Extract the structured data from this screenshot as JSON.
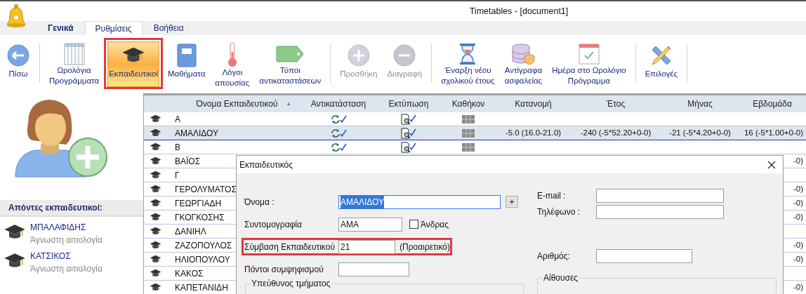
{
  "window": {
    "title": "Timetables - [document1]"
  },
  "tabs": [
    {
      "kind": "file",
      "label": "Γενικά",
      "selected": false
    },
    {
      "kind": "tab",
      "label": "Ρυθμίσεις",
      "selected": true
    },
    {
      "kind": "tab",
      "label": "Βοήθεια",
      "selected": false
    }
  ],
  "toolbar": [
    {
      "kind": "button",
      "label": "Πίσω",
      "selected": false,
      "disabled": false,
      "highlighted": false
    },
    {
      "kind": "separator"
    },
    {
      "kind": "button",
      "label": "Ωρολόγια\nΠρογράμματα",
      "selected": false,
      "disabled": false,
      "highlighted": false
    },
    {
      "kind": "button",
      "label": "Εκπαιδευτικοί",
      "selected": true,
      "disabled": false,
      "highlighted": true
    },
    {
      "kind": "button",
      "label": "Μαθήματα",
      "selected": false,
      "disabled": false,
      "highlighted": false
    },
    {
      "kind": "button",
      "label": "Λόγοι\nαπουσίας",
      "selected": false,
      "disabled": false,
      "highlighted": false
    },
    {
      "kind": "button",
      "label": "Τύποι\nαντικαταστάσεων",
      "selected": false,
      "disabled": false,
      "highlighted": false
    },
    {
      "kind": "separator"
    },
    {
      "kind": "button",
      "label": "Προσθήκη",
      "selected": false,
      "disabled": true,
      "highlighted": false
    },
    {
      "kind": "button",
      "label": "Διαγραφή",
      "selected": false,
      "disabled": true,
      "highlighted": false
    },
    {
      "kind": "separator"
    },
    {
      "kind": "button",
      "label": "Έναρξη νέου\nσχολικού έτους",
      "selected": false,
      "disabled": false,
      "highlighted": false
    },
    {
      "kind": "button",
      "label": "Αντίγραφα\nασφαλείας",
      "selected": false,
      "disabled": false,
      "highlighted": false
    },
    {
      "kind": "button",
      "label": "Ημέρα στο Ωρολόγιο\nΠρόγραμμα",
      "selected": false,
      "disabled": false,
      "highlighted": false
    },
    {
      "kind": "separator"
    },
    {
      "kind": "button",
      "label": "Επιλογές",
      "selected": false,
      "disabled": false,
      "highlighted": false
    },
    {
      "kind": "separator"
    }
  ],
  "absent_teachers": {
    "title": "Απόντες εκπαιδευτικοί:",
    "items": [
      {
        "name": "ΜΠΑΛΑΦΙΔΗΣ",
        "reason": "Άγνωστη αιτιολογία"
      },
      {
        "name": "ΚΑΤΣΙΚΟΣ",
        "reason": "Άγνωστη αιτιολογία"
      }
    ]
  },
  "table": {
    "columns": [
      {
        "label": "Όνομα Εκπαιδευτικού",
        "sort_arrow": "▲"
      },
      {
        "label": "Αντικατάσταση"
      },
      {
        "label": "Εκτύπωση"
      },
      {
        "label": "Καθήκον"
      },
      {
        "label": "Κατανομή"
      },
      {
        "label": "Έτος"
      },
      {
        "label": "Μήνας"
      },
      {
        "label": "Εβδομάδα"
      }
    ],
    "rows": [
      {
        "name": "Α",
        "selected": false,
        "icons_visible": true
      },
      {
        "name": "ΑΜΑΛΙΔΟΥ",
        "selected": true,
        "icons_visible": true,
        "allocation": "-5.0 (16.0-21.0)",
        "year": "-240 (-5*52.20+0-0)",
        "month": "-21 (-5*4.20+0-0)",
        "week": "16 (-5*1.00+0-0)"
      },
      {
        "name": "Β",
        "selected": false,
        "icons_visible": true
      },
      {
        "name": "ΒΑΪΟΣ",
        "selected": false,
        "week": "-0)"
      },
      {
        "name": "Γ",
        "selected": false
      },
      {
        "name": "ΓΕΡΟΛΥΜΑΤΟΣ",
        "selected": false,
        "week": "-0)"
      },
      {
        "name": "ΓΕΩΡΓΙΑΔΗ",
        "selected": false,
        "week": "-0)"
      },
      {
        "name": "ΓΚΟΓΚΟΣΗΣ",
        "selected": false,
        "week": "-0)"
      },
      {
        "name": "ΔΑΝΙΗΛ",
        "selected": false
      },
      {
        "name": "ΖΑΖΟΠΟΥΛΟΣ",
        "selected": false,
        "week": "-0)"
      },
      {
        "name": "ΗΛΙΟΠΟΥΛΟΥ",
        "selected": false,
        "week": "-0)"
      },
      {
        "name": "ΚΑΚΟΣ",
        "selected": false
      },
      {
        "name": "ΚΑΠΕΤΑΝΙΔΗ",
        "selected": false,
        "week": "-0)"
      }
    ]
  },
  "dialog": {
    "title": "Εκπαιδευτικός",
    "fields": [
      {
        "label": "Όνομα :",
        "value": "ΑΜΑΛΙΔΟΥ",
        "focused": true,
        "text_selected": true,
        "highlighted": false,
        "add_button": "+"
      },
      {
        "label": "Συντομογραφία",
        "value": "ΑΜΑ",
        "focused": false,
        "text_selected": false,
        "highlighted": false,
        "checkbox": {
          "label": "Άνδρας",
          "checked": false
        }
      },
      {
        "label": "Σύμβαση Εκπαιδευτικού",
        "value": "21",
        "focused": false,
        "text_selected": false,
        "highlighted": true,
        "note": "(Προαιρετικό)"
      },
      {
        "label": "Πόντοι συμψηφισμού",
        "focused": false,
        "highlighted": false
      }
    ],
    "group": "Υπεύθυνος τμήματος",
    "contact_fields": [
      {
        "label": "E-mail :"
      },
      {
        "label": "Τηλέφωνο :"
      }
    ],
    "number_field": {
      "label": "Αριθμός:"
    },
    "right_group": "Αίθουσες"
  }
}
